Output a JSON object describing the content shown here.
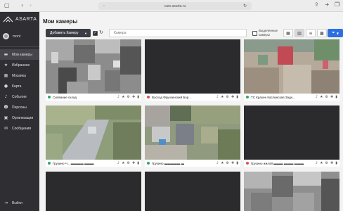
{
  "browser": {
    "url": "cars.asarta.ru",
    "back_icon": "chevron-left-icon",
    "forward_icon": "chevron-right-icon",
    "share_icon": "share-icon",
    "new_tab_icon": "plus-icon",
    "tabs_icon": "tabs-icon"
  },
  "sidebar": {
    "brand": "ASARTA",
    "user_name": "mont",
    "nav": [
      {
        "label": "Мои камеры",
        "icon": "camera-icon",
        "active": true
      },
      {
        "label": "Избранное",
        "icon": "star-icon"
      },
      {
        "label": "Мозаика",
        "icon": "grid-icon"
      },
      {
        "label": "Карта",
        "icon": "map-pin-icon"
      },
      {
        "label": "События",
        "icon": "bell-icon"
      },
      {
        "label": "Персоны",
        "icon": "person-icon"
      },
      {
        "label": "Организации",
        "icon": "building-icon"
      },
      {
        "label": "Сообщения",
        "icon": "message-icon"
      }
    ],
    "logout": "Выйти"
  },
  "main": {
    "title": "Мои камеры",
    "add_button": "Добавить Камеру",
    "search_placeholder": "Камера",
    "selected_label": "Выделенные камеры"
  },
  "colors": {
    "sidebar_bg": "#2f2f33",
    "accent_blue": "#2d6fe0",
    "status_green": "#2fa56a",
    "status_red": "#d9534f"
  },
  "cameras": [
    {
      "name": "Силваниe склад",
      "status": "online"
    },
    {
      "name": "Восход Фрунзенский Бор...",
      "status": "offline"
    },
    {
      "name": "ТС Крахее  Каслинская Задн...",
      "status": "online"
    },
    {
      "name": "Грузино Ч... ▬▬▬▬ ▬▬▬",
      "status": "online"
    },
    {
      "name": "Грузино  ▬▬▬▬▬ ▬",
      "status": "online"
    },
    {
      "name": "Грузино жилой  ▬▬▬ ▬▬▬ ▬▬▬",
      "status": "offline"
    },
    {
      "name": "",
      "status": "offline"
    },
    {
      "name": "",
      "status": "offline"
    },
    {
      "name": "",
      "status": "online"
    }
  ]
}
